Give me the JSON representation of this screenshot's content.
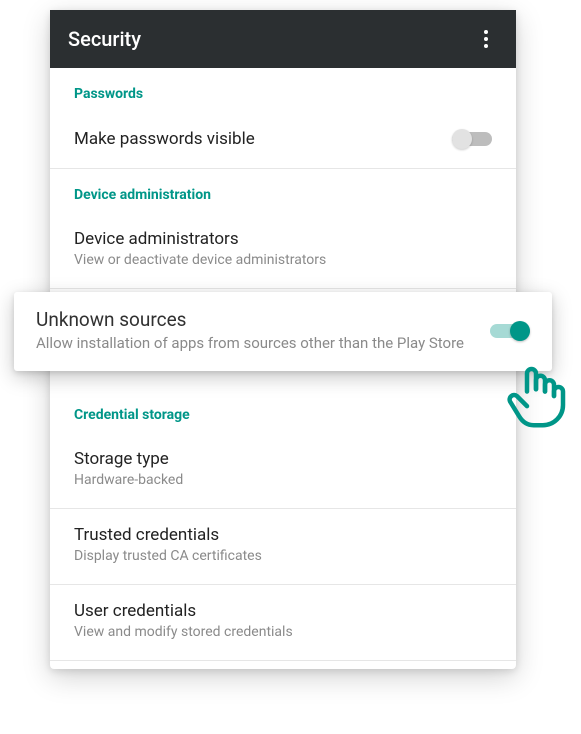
{
  "appbar": {
    "title": "Security"
  },
  "sections": {
    "passwords": {
      "header": "Passwords",
      "make_visible": {
        "title": "Make passwords visible"
      }
    },
    "device_admin": {
      "header": "Device administration",
      "administrators": {
        "title": "Device administrators",
        "subtitle": "View or deactivate device administrators"
      },
      "unknown_sources": {
        "title": "Unknown sources",
        "subtitle": "Allow installation of apps from sources other than the Play Store"
      }
    },
    "credential_storage": {
      "header": "Credential storage",
      "storage_type": {
        "title": "Storage type",
        "subtitle": "Hardware-backed"
      },
      "trusted_credentials": {
        "title": "Trusted credentials",
        "subtitle": "Display trusted CA certificates"
      },
      "user_credentials": {
        "title": "User credentials",
        "subtitle": "View and modify stored credentials"
      }
    }
  },
  "colors": {
    "accent": "#009688",
    "appbar_bg": "#2b2f31"
  }
}
